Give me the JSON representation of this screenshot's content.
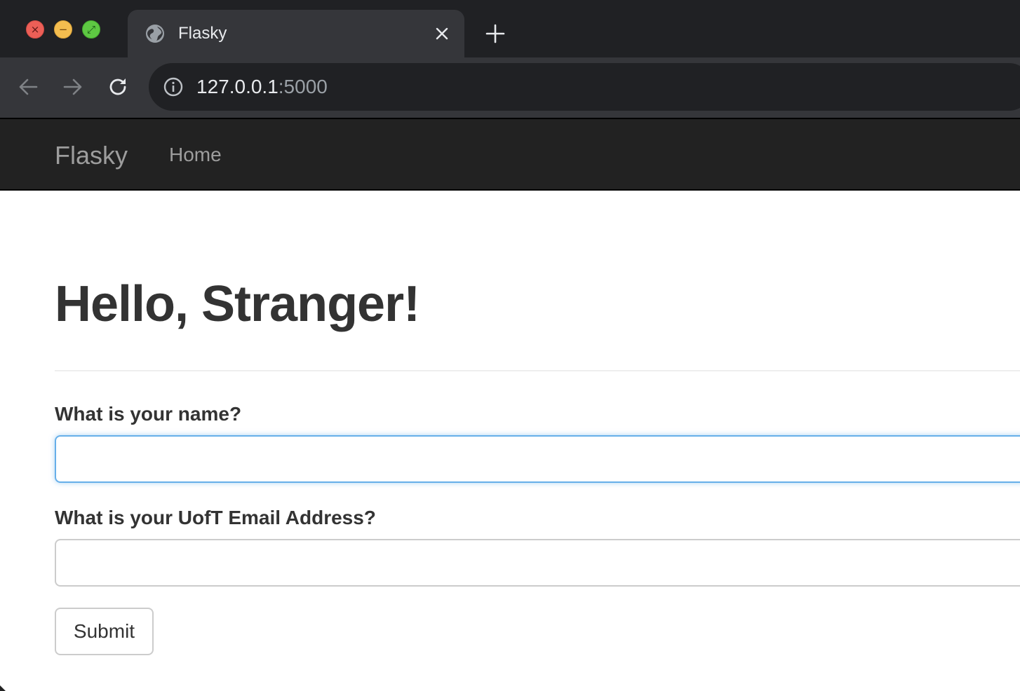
{
  "browser": {
    "tab_title": "Flasky",
    "url_host": "127.0.0.1",
    "url_port": ":5000",
    "icons": {
      "close": "close-window-icon",
      "minimize": "minimize-window-icon",
      "maximize": "maximize-window-icon",
      "tab_favicon": "globe-icon",
      "tab_close": "close-icon",
      "new_tab": "plus-icon",
      "back": "arrow-left-icon",
      "forward": "arrow-right-icon",
      "reload": "reload-icon",
      "site_info": "info-icon"
    }
  },
  "navbar": {
    "brand": "Flasky",
    "items": [
      {
        "label": "Home"
      }
    ]
  },
  "main": {
    "heading": "Hello, Stranger!",
    "form": {
      "name_label": "What is your name?",
      "name_value": "",
      "email_label": "What is your UofT Email Address?",
      "email_value": "",
      "submit_label": "Submit"
    }
  },
  "colors": {
    "navbar_bg": "#222222",
    "navbar_text": "#9d9d9d",
    "focus_border": "#66afe9",
    "text": "#333333"
  }
}
